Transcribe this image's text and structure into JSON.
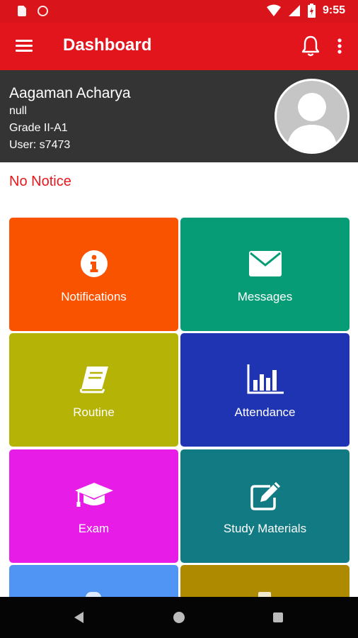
{
  "status_bar": {
    "time": "9:55"
  },
  "app_bar": {
    "title": "Dashboard"
  },
  "profile": {
    "name": "Aagaman Acharya",
    "line2": "null",
    "grade": "Grade II-A1",
    "user": "User: s7473"
  },
  "notice": "No Notice",
  "tiles": [
    {
      "label": "Notifications",
      "icon": "info-icon",
      "color": "#fa5300"
    },
    {
      "label": "Messages",
      "icon": "envelope-icon",
      "color": "#069d76"
    },
    {
      "label": "Routine",
      "icon": "book-icon",
      "color": "#b5b305"
    },
    {
      "label": "Attendance",
      "icon": "bar-chart-icon",
      "color": "#1f34b3"
    },
    {
      "label": "Exam",
      "icon": "graduation-cap-icon",
      "color": "#e81ce7"
    },
    {
      "label": "Study Materials",
      "icon": "edit-icon",
      "color": "#127a82"
    },
    {
      "label": "",
      "icon": "partially-visible-icon",
      "color": "#5195f4"
    },
    {
      "label": "",
      "icon": "partially-visible-icon",
      "color": "#ad8a00"
    }
  ]
}
